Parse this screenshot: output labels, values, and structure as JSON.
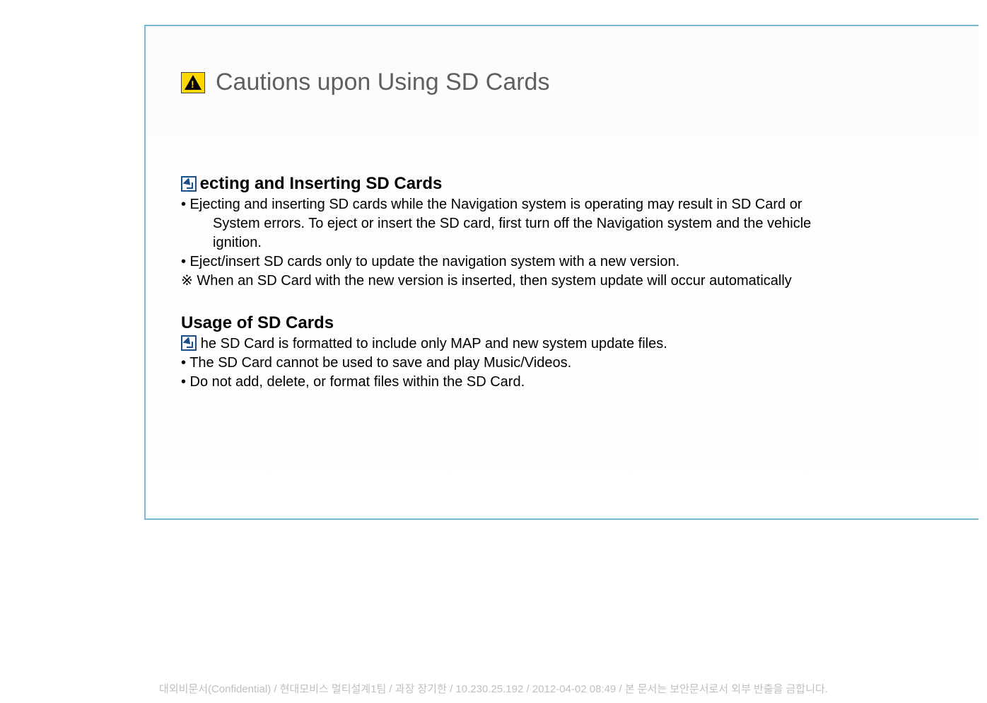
{
  "title": {
    "plain": "Cautions upon Using SD Cards"
  },
  "section1": {
    "heading_visible": "ecting and Inserting SD Cards",
    "line1": "• Ejecting and inserting SD cards while the Navigation system is operating may result in SD Card or",
    "line1b": "System errors. To eject or insert the SD card, first turn off the Navigation system and the vehicle",
    "line1c": "ignition.",
    "line2": "• Eject/insert SD cards only to update the navigation system with a new version.",
    "line3": "※ When an SD Card with the new version is inserted, then system update will occur automatically"
  },
  "section2": {
    "heading": "Usage of SD Cards",
    "line1_visible": "he SD Card is formatted to include only MAP and new system update files.",
    "line2": "• The SD Card cannot be used to save and play Music/Videos.",
    "line3": "• Do not add, delete, or format files within the SD Card."
  },
  "footer": "대외비문서(Confidential) / 현대모비스 멀티설계1팀 / 과장 장기한 / 10.230.25.192 / 2012-04-02 08:49 /  본 문서는 보안문서로서 외부 반출을 금합니다."
}
